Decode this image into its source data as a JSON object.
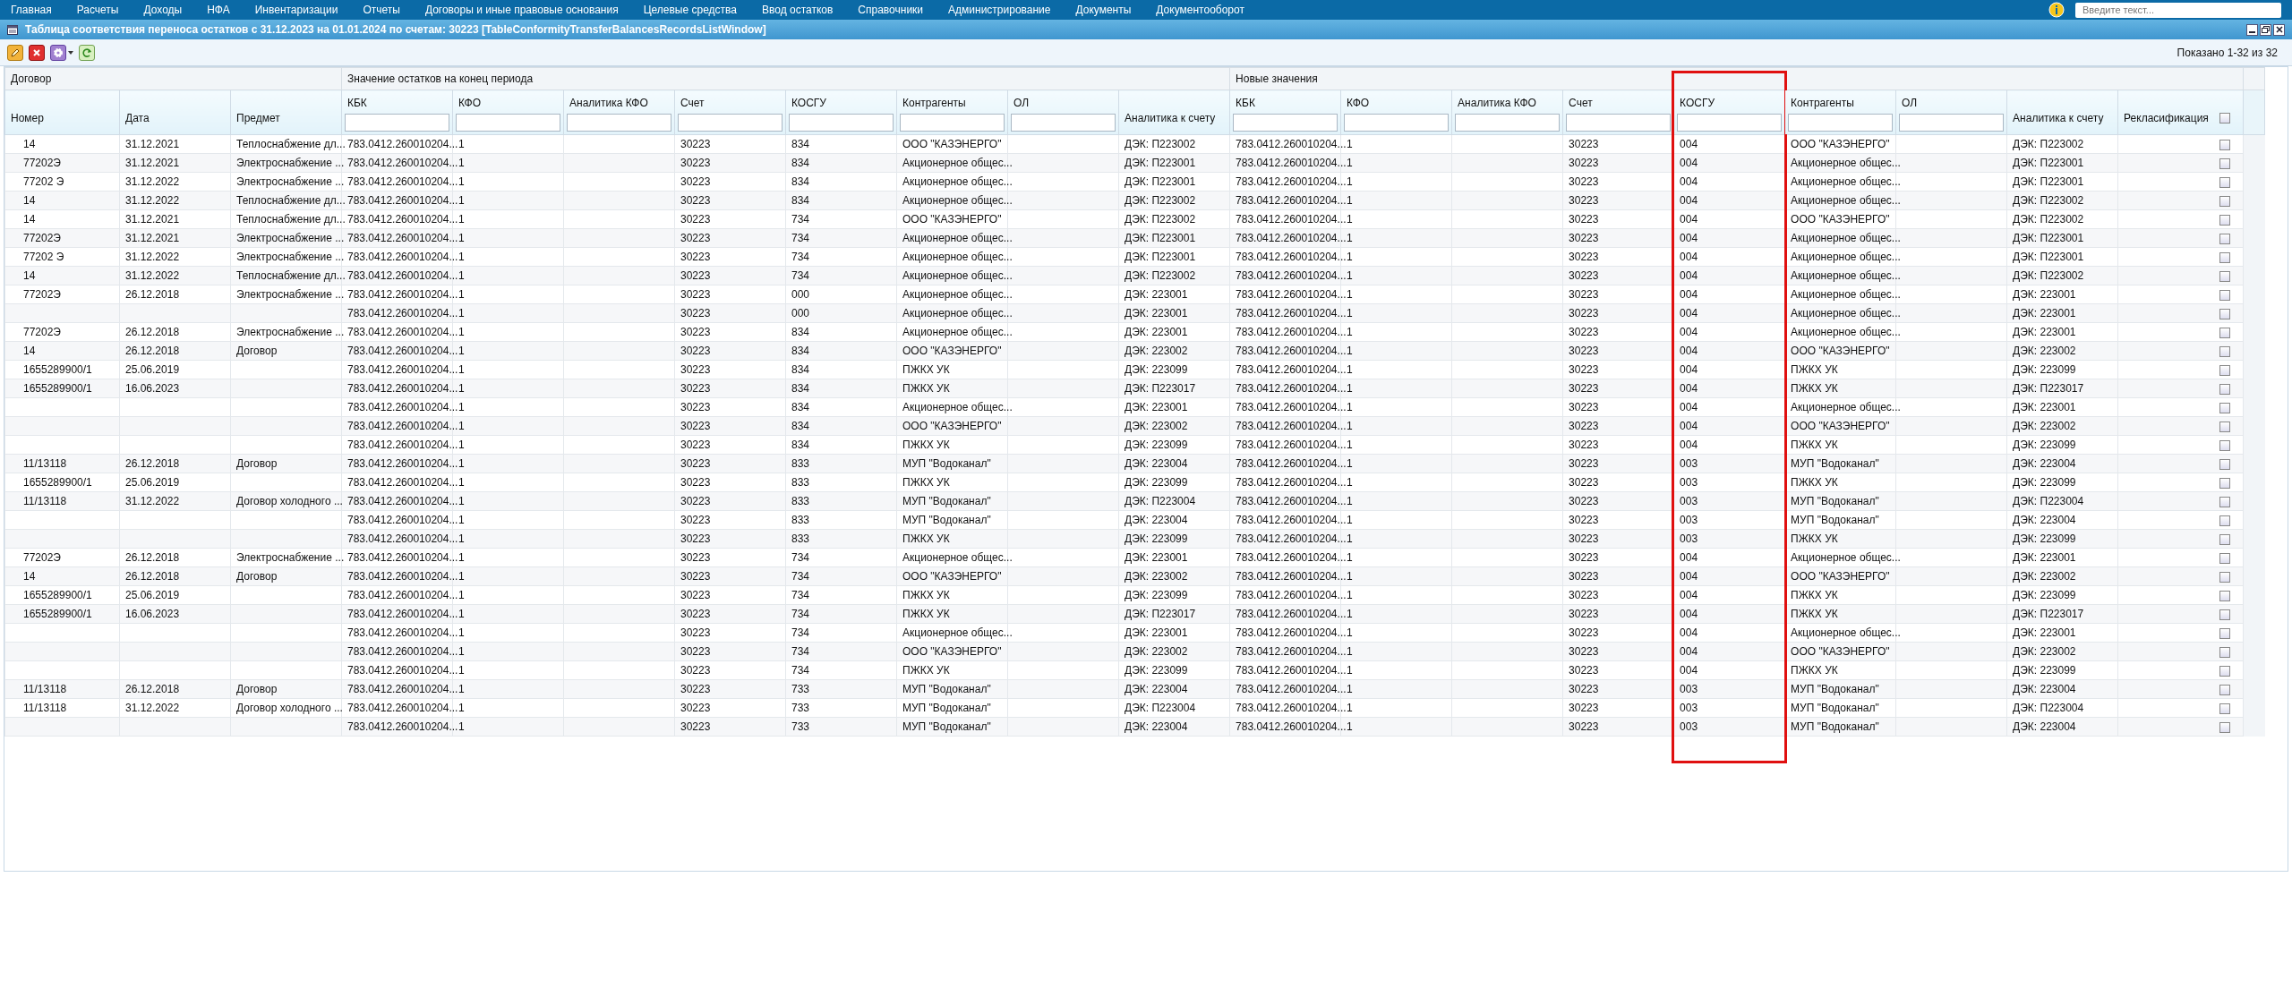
{
  "menu": [
    "Главная",
    "Расчеты",
    "Доходы",
    "НФА",
    "Инвентаризации",
    "Отчеты",
    "Договоры и иные правовые основания",
    "Целевые средства",
    "Ввод остатков",
    "Справочники",
    "Администрирование",
    "Документы",
    "Документооборот"
  ],
  "search": {
    "placeholder": "Введите текст..."
  },
  "window": {
    "title": "Таблица соответствия переноса остатков с 31.12.2023 на 01.01.2024 по счетам: 30223 [TableConformityTransferBalancesRecordsListWindow]"
  },
  "toolbar": {
    "shown": "Показано 1-32 из 32"
  },
  "groups": [
    {
      "label": "Договор",
      "columns": [
        {
          "label": "Номер",
          "kind": "plain"
        },
        {
          "label": "Дата",
          "kind": "plain"
        },
        {
          "label": "Предмет",
          "kind": "plain"
        }
      ]
    },
    {
      "label": "Значение остатков на конец периода",
      "columns": [
        {
          "label": "КБК",
          "kind": "filter"
        },
        {
          "label": "КФО",
          "kind": "filter"
        },
        {
          "label": "Аналитика КФО",
          "kind": "filter"
        },
        {
          "label": "Счет",
          "kind": "filter"
        },
        {
          "label": "КОСГУ",
          "kind": "filter"
        },
        {
          "label": "Контрагенты",
          "kind": "filter"
        },
        {
          "label": "ОЛ",
          "kind": "filter"
        },
        {
          "label": "Аналитика к счету",
          "kind": "plain"
        }
      ]
    },
    {
      "label": "Новые значения",
      "columns": [
        {
          "label": "КБК",
          "kind": "filter"
        },
        {
          "label": "КФО",
          "kind": "filter"
        },
        {
          "label": "Аналитика КФО",
          "kind": "filter"
        },
        {
          "label": "Счет",
          "kind": "filter"
        },
        {
          "label": "КОСГУ",
          "kind": "highlighted"
        },
        {
          "label": "Контрагенты",
          "kind": "filter"
        },
        {
          "label": "ОЛ",
          "kind": "filter"
        },
        {
          "label": "Аналитика к счету",
          "kind": "plain"
        },
        {
          "label": "Рекласификация",
          "kind": "checkbox",
          "checked": false
        }
      ]
    }
  ],
  "rows": [
    {
      "number": "14",
      "date": "31.12.2021",
      "subject": "Теплоснабжение дл...",
      "kbk": "783.0412.260010204...",
      "kfo": "1",
      "account": "30223",
      "kosgu": "834",
      "counterparty": "ООО \"КАЗЭНЕРГО\"",
      "account_analytics": "ДЭК: П223002",
      "new_kbk": "783.0412.260010204...",
      "new_kfo": "1",
      "new_account": "30223",
      "new_kosgu": "004",
      "new_counterparty": "ООО \"КАЗЭНЕРГО\"",
      "new_account_analytics": "ДЭК: П223002",
      "reclassification": false
    },
    {
      "number": "77202Э",
      "date": "31.12.2021",
      "subject": "Электроснабжение ...",
      "kbk": "783.0412.260010204...",
      "kfo": "1",
      "account": "30223",
      "kosgu": "834",
      "counterparty": "Акционерное общес...",
      "account_analytics": "ДЭК: П223001",
      "new_kbk": "783.0412.260010204...",
      "new_kfo": "1",
      "new_account": "30223",
      "new_kosgu": "004",
      "new_counterparty": "Акционерное общес...",
      "new_account_analytics": "ДЭК: П223001",
      "reclassification": false
    },
    {
      "number": "77202 Э",
      "date": "31.12.2022",
      "subject": "Электроснабжение ...",
      "kbk": "783.0412.260010204...",
      "kfo": "1",
      "account": "30223",
      "kosgu": "834",
      "counterparty": "Акционерное общес...",
      "account_analytics": "ДЭК: П223001",
      "new_kbk": "783.0412.260010204...",
      "new_kfo": "1",
      "new_account": "30223",
      "new_kosgu": "004",
      "new_counterparty": "Акционерное общес...",
      "new_account_analytics": "ДЭК: П223001",
      "reclassification": false
    },
    {
      "number": "14",
      "date": "31.12.2022",
      "subject": "Теплоснабжение дл...",
      "kbk": "783.0412.260010204...",
      "kfo": "1",
      "account": "30223",
      "kosgu": "834",
      "counterparty": "Акционерное общес...",
      "account_analytics": "ДЭК: П223002",
      "new_kbk": "783.0412.260010204...",
      "new_kfo": "1",
      "new_account": "30223",
      "new_kosgu": "004",
      "new_counterparty": "Акционерное общес...",
      "new_account_analytics": "ДЭК: П223002",
      "reclassification": false
    },
    {
      "number": "14",
      "date": "31.12.2021",
      "subject": "Теплоснабжение дл...",
      "kbk": "783.0412.260010204...",
      "kfo": "1",
      "account": "30223",
      "kosgu": "734",
      "counterparty": "ООО \"КАЗЭНЕРГО\"",
      "account_analytics": "ДЭК: П223002",
      "new_kbk": "783.0412.260010204...",
      "new_kfo": "1",
      "new_account": "30223",
      "new_kosgu": "004",
      "new_counterparty": "ООО \"КАЗЭНЕРГО\"",
      "new_account_analytics": "ДЭК: П223002",
      "reclassification": false
    },
    {
      "number": "77202Э",
      "date": "31.12.2021",
      "subject": "Электроснабжение ...",
      "kbk": "783.0412.260010204...",
      "kfo": "1",
      "account": "30223",
      "kosgu": "734",
      "counterparty": "Акционерное общес...",
      "account_analytics": "ДЭК: П223001",
      "new_kbk": "783.0412.260010204...",
      "new_kfo": "1",
      "new_account": "30223",
      "new_kosgu": "004",
      "new_counterparty": "Акционерное общес...",
      "new_account_analytics": "ДЭК: П223001",
      "reclassification": false
    },
    {
      "number": "77202 Э",
      "date": "31.12.2022",
      "subject": "Электроснабжение ...",
      "kbk": "783.0412.260010204...",
      "kfo": "1",
      "account": "30223",
      "kosgu": "734",
      "counterparty": "Акционерное общес...",
      "account_analytics": "ДЭК: П223001",
      "new_kbk": "783.0412.260010204...",
      "new_kfo": "1",
      "new_account": "30223",
      "new_kosgu": "004",
      "new_counterparty": "Акционерное общес...",
      "new_account_analytics": "ДЭК: П223001",
      "reclassification": false
    },
    {
      "number": "14",
      "date": "31.12.2022",
      "subject": "Теплоснабжение дл...",
      "kbk": "783.0412.260010204...",
      "kfo": "1",
      "account": "30223",
      "kosgu": "734",
      "counterparty": "Акционерное общес...",
      "account_analytics": "ДЭК: П223002",
      "new_kbk": "783.0412.260010204...",
      "new_kfo": "1",
      "new_account": "30223",
      "new_kosgu": "004",
      "new_counterparty": "Акционерное общес...",
      "new_account_analytics": "ДЭК: П223002",
      "reclassification": false
    },
    {
      "number": "77202Э",
      "date": "26.12.2018",
      "subject": "Электроснабжение ...",
      "kbk": "783.0412.260010204...",
      "kfo": "1",
      "account": "30223",
      "kosgu": "000",
      "counterparty": "Акционерное общес...",
      "account_analytics": "ДЭК: 223001",
      "new_kbk": "783.0412.260010204...",
      "new_kfo": "1",
      "new_account": "30223",
      "new_kosgu": "004",
      "new_counterparty": "Акционерное общес...",
      "new_account_analytics": "ДЭК: 223001",
      "reclassification": false
    },
    {
      "kbk": "783.0412.260010204...",
      "kfo": "1",
      "account": "30223",
      "kosgu": "000",
      "counterparty": "Акционерное общес...",
      "account_analytics": "ДЭК: 223001",
      "new_kbk": "783.0412.260010204...",
      "new_kfo": "1",
      "new_account": "30223",
      "new_kosgu": "004",
      "new_counterparty": "Акционерное общес...",
      "new_account_analytics": "ДЭК: 223001",
      "reclassification": false
    },
    {
      "number": "77202Э",
      "date": "26.12.2018",
      "subject": "Электроснабжение ...",
      "kbk": "783.0412.260010204...",
      "kfo": "1",
      "account": "30223",
      "kosgu": "834",
      "counterparty": "Акционерное общес...",
      "account_analytics": "ДЭК: 223001",
      "new_kbk": "783.0412.260010204...",
      "new_kfo": "1",
      "new_account": "30223",
      "new_kosgu": "004",
      "new_counterparty": "Акционерное общес...",
      "new_account_analytics": "ДЭК: 223001",
      "reclassification": false
    },
    {
      "number": "14",
      "date": "26.12.2018",
      "subject": "Договор",
      "kbk": "783.0412.260010204...",
      "kfo": "1",
      "account": "30223",
      "kosgu": "834",
      "counterparty": "ООО \"КАЗЭНЕРГО\"",
      "account_analytics": "ДЭК: 223002",
      "new_kbk": "783.0412.260010204...",
      "new_kfo": "1",
      "new_account": "30223",
      "new_kosgu": "004",
      "new_counterparty": "ООО \"КАЗЭНЕРГО\"",
      "new_account_analytics": "ДЭК: 223002",
      "reclassification": false
    },
    {
      "number": "1655289900/1",
      "date": "25.06.2019",
      "kbk": "783.0412.260010204...",
      "kfo": "1",
      "account": "30223",
      "kosgu": "834",
      "counterparty": "ПЖКХ УК",
      "account_analytics": "ДЭК: 223099",
      "new_kbk": "783.0412.260010204...",
      "new_kfo": "1",
      "new_account": "30223",
      "new_kosgu": "004",
      "new_counterparty": "ПЖКХ УК",
      "new_account_analytics": "ДЭК: 223099",
      "reclassification": false
    },
    {
      "number": "1655289900/1",
      "date": "16.06.2023",
      "kbk": "783.0412.260010204...",
      "kfo": "1",
      "account": "30223",
      "kosgu": "834",
      "counterparty": "ПЖКХ УК",
      "account_analytics": "ДЭК: П223017",
      "new_kbk": "783.0412.260010204...",
      "new_kfo": "1",
      "new_account": "30223",
      "new_kosgu": "004",
      "new_counterparty": "ПЖКХ УК",
      "new_account_analytics": "ДЭК: П223017",
      "reclassification": false
    },
    {
      "kbk": "783.0412.260010204...",
      "kfo": "1",
      "account": "30223",
      "kosgu": "834",
      "counterparty": "Акционерное общес...",
      "account_analytics": "ДЭК: 223001",
      "new_kbk": "783.0412.260010204...",
      "new_kfo": "1",
      "new_account": "30223",
      "new_kosgu": "004",
      "new_counterparty": "Акционерное общес...",
      "new_account_analytics": "ДЭК: 223001",
      "reclassification": false
    },
    {
      "kbk": "783.0412.260010204...",
      "kfo": "1",
      "account": "30223",
      "kosgu": "834",
      "counterparty": "ООО \"КАЗЭНЕРГО\"",
      "account_analytics": "ДЭК: 223002",
      "new_kbk": "783.0412.260010204...",
      "new_kfo": "1",
      "new_account": "30223",
      "new_kosgu": "004",
      "new_counterparty": "ООО \"КАЗЭНЕРГО\"",
      "new_account_analytics": "ДЭК: 223002",
      "reclassification": false
    },
    {
      "kbk": "783.0412.260010204...",
      "kfo": "1",
      "account": "30223",
      "kosgu": "834",
      "counterparty": "ПЖКХ УК",
      "account_analytics": "ДЭК: 223099",
      "new_kbk": "783.0412.260010204...",
      "new_kfo": "1",
      "new_account": "30223",
      "new_kosgu": "004",
      "new_counterparty": "ПЖКХ УК",
      "new_account_analytics": "ДЭК: 223099",
      "reclassification": false
    },
    {
      "number": "11/13118",
      "date": "26.12.2018",
      "subject": "Договор",
      "kbk": "783.0412.260010204...",
      "kfo": "1",
      "account": "30223",
      "kosgu": "833",
      "counterparty": "МУП \"Водоканал\"",
      "account_analytics": "ДЭК: 223004",
      "new_kbk": "783.0412.260010204...",
      "new_kfo": "1",
      "new_account": "30223",
      "new_kosgu": "003",
      "new_counterparty": "МУП \"Водоканал\"",
      "new_account_analytics": "ДЭК: 223004",
      "reclassification": false
    },
    {
      "number": "1655289900/1",
      "date": "25.06.2019",
      "kbk": "783.0412.260010204...",
      "kfo": "1",
      "account": "30223",
      "kosgu": "833",
      "counterparty": "ПЖКХ УК",
      "account_analytics": "ДЭК: 223099",
      "new_kbk": "783.0412.260010204...",
      "new_kfo": "1",
      "new_account": "30223",
      "new_kosgu": "003",
      "new_counterparty": "ПЖКХ УК",
      "new_account_analytics": "ДЭК: 223099",
      "reclassification": false
    },
    {
      "number": "11/13118",
      "date": "31.12.2022",
      "subject": "Договор холодного ...",
      "kbk": "783.0412.260010204...",
      "kfo": "1",
      "account": "30223",
      "kosgu": "833",
      "counterparty": "МУП \"Водоканал\"",
      "account_analytics": "ДЭК: П223004",
      "new_kbk": "783.0412.260010204...",
      "new_kfo": "1",
      "new_account": "30223",
      "new_kosgu": "003",
      "new_counterparty": "МУП \"Водоканал\"",
      "new_account_analytics": "ДЭК: П223004",
      "reclassification": false
    },
    {
      "kbk": "783.0412.260010204...",
      "kfo": "1",
      "account": "30223",
      "kosgu": "833",
      "counterparty": "МУП \"Водоканал\"",
      "account_analytics": "ДЭК: 223004",
      "new_kbk": "783.0412.260010204...",
      "new_kfo": "1",
      "new_account": "30223",
      "new_kosgu": "003",
      "new_counterparty": "МУП \"Водоканал\"",
      "new_account_analytics": "ДЭК: 223004",
      "reclassification": false
    },
    {
      "kbk": "783.0412.260010204...",
      "kfo": "1",
      "account": "30223",
      "kosgu": "833",
      "counterparty": "ПЖКХ УК",
      "account_analytics": "ДЭК: 223099",
      "new_kbk": "783.0412.260010204...",
      "new_kfo": "1",
      "new_account": "30223",
      "new_kosgu": "003",
      "new_counterparty": "ПЖКХ УК",
      "new_account_analytics": "ДЭК: 223099",
      "reclassification": false
    },
    {
      "number": "77202Э",
      "date": "26.12.2018",
      "subject": "Электроснабжение ...",
      "kbk": "783.0412.260010204...",
      "kfo": "1",
      "account": "30223",
      "kosgu": "734",
      "counterparty": "Акционерное общес...",
      "account_analytics": "ДЭК: 223001",
      "new_kbk": "783.0412.260010204...",
      "new_kfo": "1",
      "new_account": "30223",
      "new_kosgu": "004",
      "new_counterparty": "Акционерное общес...",
      "new_account_analytics": "ДЭК: 223001",
      "reclassification": false
    },
    {
      "number": "14",
      "date": "26.12.2018",
      "subject": "Договор",
      "kbk": "783.0412.260010204...",
      "kfo": "1",
      "account": "30223",
      "kosgu": "734",
      "counterparty": "ООО \"КАЗЭНЕРГО\"",
      "account_analytics": "ДЭК: 223002",
      "new_kbk": "783.0412.260010204...",
      "new_kfo": "1",
      "new_account": "30223",
      "new_kosgu": "004",
      "new_counterparty": "ООО \"КАЗЭНЕРГО\"",
      "new_account_analytics": "ДЭК: 223002",
      "reclassification": false
    },
    {
      "number": "1655289900/1",
      "date": "25.06.2019",
      "kbk": "783.0412.260010204...",
      "kfo": "1",
      "account": "30223",
      "kosgu": "734",
      "counterparty": "ПЖКХ УК",
      "account_analytics": "ДЭК: 223099",
      "new_kbk": "783.0412.260010204...",
      "new_kfo": "1",
      "new_account": "30223",
      "new_kosgu": "004",
      "new_counterparty": "ПЖКХ УК",
      "new_account_analytics": "ДЭК: 223099",
      "reclassification": false
    },
    {
      "number": "1655289900/1",
      "date": "16.06.2023",
      "kbk": "783.0412.260010204...",
      "kfo": "1",
      "account": "30223",
      "kosgu": "734",
      "counterparty": "ПЖКХ УК",
      "account_analytics": "ДЭК: П223017",
      "new_kbk": "783.0412.260010204...",
      "new_kfo": "1",
      "new_account": "30223",
      "new_kosgu": "004",
      "new_counterparty": "ПЖКХ УК",
      "new_account_analytics": "ДЭК: П223017",
      "reclassification": false
    },
    {
      "kbk": "783.0412.260010204...",
      "kfo": "1",
      "account": "30223",
      "kosgu": "734",
      "counterparty": "Акционерное общес...",
      "account_analytics": "ДЭК: 223001",
      "new_kbk": "783.0412.260010204...",
      "new_kfo": "1",
      "new_account": "30223",
      "new_kosgu": "004",
      "new_counterparty": "Акционерное общес...",
      "new_account_analytics": "ДЭК: 223001",
      "reclassification": false
    },
    {
      "kbk": "783.0412.260010204...",
      "kfo": "1",
      "account": "30223",
      "kosgu": "734",
      "counterparty": "ООО \"КАЗЭНЕРГО\"",
      "account_analytics": "ДЭК: 223002",
      "new_kbk": "783.0412.260010204...",
      "new_kfo": "1",
      "new_account": "30223",
      "new_kosgu": "004",
      "new_counterparty": "ООО \"КАЗЭНЕРГО\"",
      "new_account_analytics": "ДЭК: 223002",
      "reclassification": false
    },
    {
      "kbk": "783.0412.260010204...",
      "kfo": "1",
      "account": "30223",
      "kosgu": "734",
      "counterparty": "ПЖКХ УК",
      "account_analytics": "ДЭК: 223099",
      "new_kbk": "783.0412.260010204...",
      "new_kfo": "1",
      "new_account": "30223",
      "new_kosgu": "004",
      "new_counterparty": "ПЖКХ УК",
      "new_account_analytics": "ДЭК: 223099",
      "reclassification": false
    },
    {
      "number": "11/13118",
      "date": "26.12.2018",
      "subject": "Договор",
      "kbk": "783.0412.260010204...",
      "kfo": "1",
      "account": "30223",
      "kosgu": "733",
      "counterparty": "МУП \"Водоканал\"",
      "account_analytics": "ДЭК: 223004",
      "new_kbk": "783.0412.260010204...",
      "new_kfo": "1",
      "new_account": "30223",
      "new_kosgu": "003",
      "new_counterparty": "МУП \"Водоканал\"",
      "new_account_analytics": "ДЭК: 223004",
      "reclassification": false
    },
    {
      "number": "11/13118",
      "date": "31.12.2022",
      "subject": "Договор холодного ...",
      "kbk": "783.0412.260010204...",
      "kfo": "1",
      "account": "30223",
      "kosgu": "733",
      "counterparty": "МУП \"Водоканал\"",
      "account_analytics": "ДЭК: П223004",
      "new_kbk": "783.0412.260010204...",
      "new_kfo": "1",
      "new_account": "30223",
      "new_kosgu": "003",
      "new_counterparty": "МУП \"Водоканал\"",
      "new_account_analytics": "ДЭК: П223004",
      "reclassification": false
    },
    {
      "kbk": "783.0412.260010204...",
      "kfo": "1",
      "account": "30223",
      "kosgu": "733",
      "counterparty": "МУП \"Водоканал\"",
      "account_analytics": "ДЭК: 223004",
      "new_kbk": "783.0412.260010204...",
      "new_kfo": "1",
      "new_account": "30223",
      "new_kosgu": "003",
      "new_counterparty": "МУП \"Водоканал\"",
      "new_account_analytics": "ДЭК: 223004",
      "reclassification": false
    }
  ]
}
